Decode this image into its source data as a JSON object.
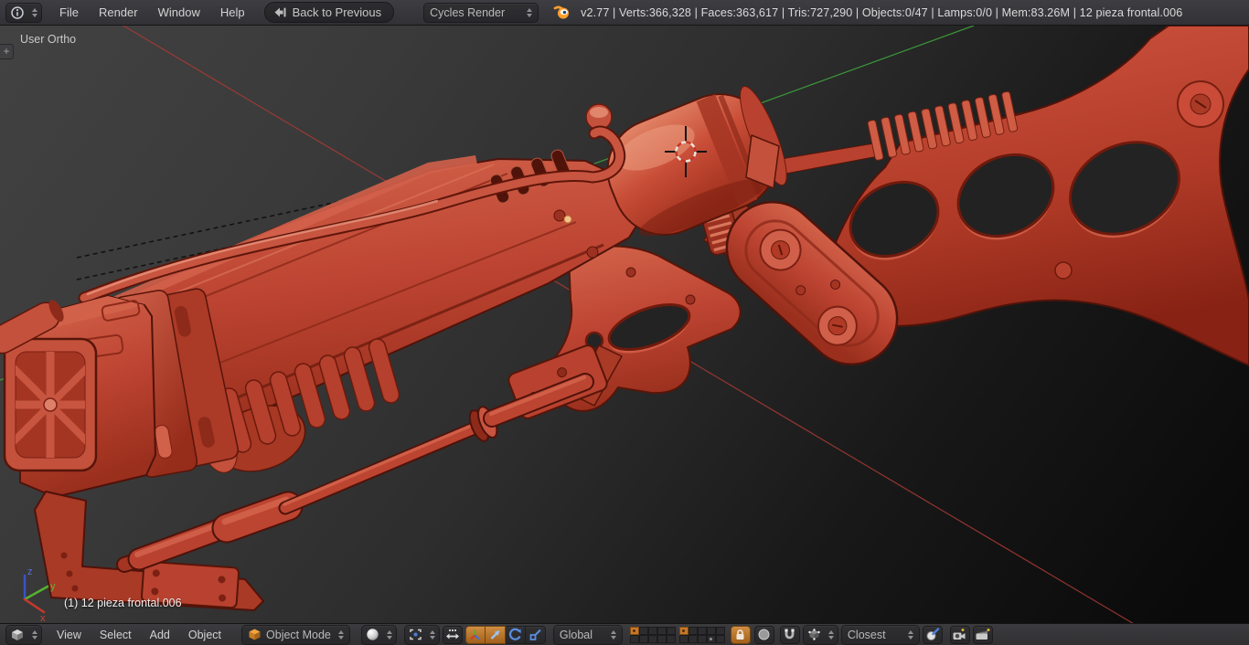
{
  "top_bar": {
    "menus": [
      "File",
      "Render",
      "Window",
      "Help"
    ],
    "back_button": "Back to Previous",
    "engine_select": "Cycles Render",
    "stats": "v2.77 | Verts:366,328 | Faces:363,617 | Tris:727,290 | Objects:0/47 | Lamps:0/0 | Mem:83.26M | 12 pieza frontal.006"
  },
  "viewport": {
    "view_label": "User Ortho",
    "toolshelf_tab": "+",
    "object_label": "(1) 12 pieza frontal.006",
    "gizmo": {
      "x": "x",
      "y": "y",
      "z": "z"
    },
    "colors": {
      "axis_x": "#c8382a",
      "axis_y": "#55b22e",
      "axis_z": "#3b53c4",
      "grid_x_line": "#a83a34",
      "grid_y_line": "#3fae3f",
      "model_base": "#bf4335",
      "model_light": "#da7258",
      "model_dark": "#8e2a1b",
      "background_top": "#424242",
      "background_bottom": "#0a0a0a"
    }
  },
  "bottom_bar": {
    "menus": [
      "View",
      "Select",
      "Add",
      "Object"
    ],
    "mode_select": "Object Mode",
    "orientation_select": "Global",
    "snap_target_select": "Closest",
    "layers": {
      "group1": "A.........",
      "group2": "A.......o."
    },
    "accent": "#c8762c"
  },
  "icons": {
    "info-editor-icon": "circled letter i",
    "back-icon": "left arrow with bar",
    "blender-logo": "orange blender swirl",
    "editor-type-icon": "grey 3d cube",
    "object-mode-cube-icon": "orange 3d cube",
    "shading-sphere-icon": "white matcap sphere",
    "pivot-point-icon": "brackets with center dot",
    "manipulate-centers-icon": "double-headed arrow with dots",
    "manipulator-axes-icon": "rgb axes star",
    "translate-icon": "blue arrow",
    "rotate-icon": "blue arc",
    "scale-icon": "blue square with diagonal",
    "lock-camera-layers-icon": "padlock",
    "proportional-edit-icon": "grey circle",
    "snap-magnet-icon": "horseshoe magnet",
    "snap-element-icon": "cube with vertex dots",
    "align-rotation-icon": "circle with blue pen",
    "opengl-render-icon": "camera",
    "opengl-anim-icon": "clapperboard",
    "cursor-3d": "red-white dashed circle with cross"
  }
}
